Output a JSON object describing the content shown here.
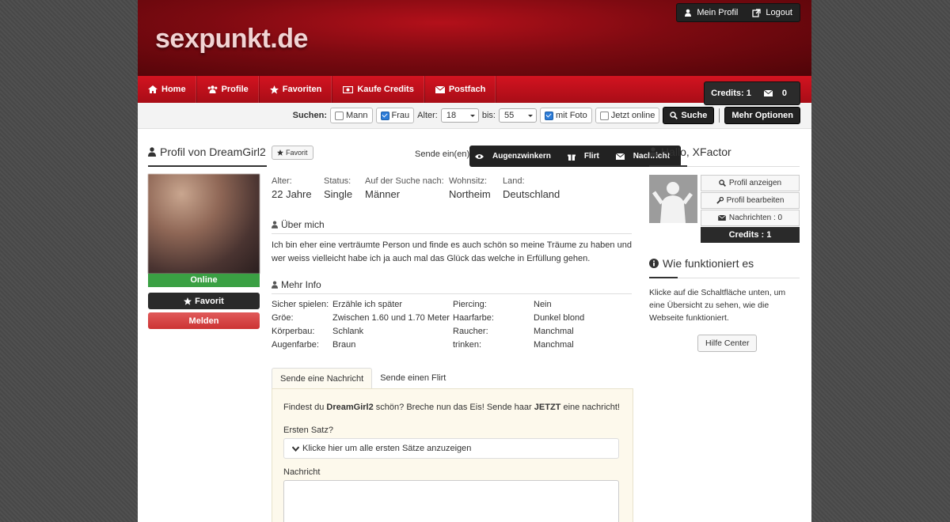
{
  "site": {
    "logo": "sexpunkt.de"
  },
  "toplinks": {
    "profile": "Mein Profil",
    "logout": "Logout"
  },
  "nav": {
    "items": [
      "Home",
      "Profile",
      "Favoriten",
      "Kaufe Credits",
      "Postfach"
    ],
    "credits": "Credits: 1",
    "messages": "0"
  },
  "search": {
    "label": "Suchen:",
    "mann": "Mann",
    "frau": "Frau",
    "alter_label": "Alter:",
    "alter_from": "18",
    "bis_label": "bis:",
    "alter_to": "55",
    "mit_foto": "mit Foto",
    "jetzt_online": "Jetzt online",
    "submit": "Suche",
    "more": "Mehr Optionen"
  },
  "profile": {
    "title": "Profil von DreamGirl2",
    "fav_small": "Favorit",
    "sende_label": "Sende ein(en):",
    "actions": [
      "Augenzwinkern",
      "Flirt",
      "Nachricht"
    ],
    "status_badge": "Online",
    "fav_button": "Favorit",
    "report_button": "Melden",
    "facts": [
      {
        "key": "Alter:",
        "value": "22 Jahre"
      },
      {
        "key": "Status:",
        "value": "Single"
      },
      {
        "key": "Auf der Suche nach:",
        "value": "Männer"
      },
      {
        "key": "Wohnsitz:",
        "value": "Northeim"
      },
      {
        "key": "Land:",
        "value": "Deutschland"
      }
    ],
    "about_title": "Über mich",
    "about_text": "Ich bin eher eine verträumte Person und finde es auch schön so meine Träume zu haben und wer weiss vielleicht habe ich ja auch mal das Glück das welche in Erfüllung gehen.",
    "more_title": "Mehr Info",
    "more_left": [
      {
        "key": "Sicher spielen:",
        "value": "Erzähle ich später"
      },
      {
        "key": "Gröe:",
        "value": "Zwischen 1.60 und 1.70 Meter"
      },
      {
        "key": "Körperbau:",
        "value": "Schlank"
      },
      {
        "key": "Augenfarbe:",
        "value": "Braun"
      }
    ],
    "more_right": [
      {
        "key": "Piercing:",
        "value": "Nein"
      },
      {
        "key": "Haarfarbe:",
        "value": "Dunkel blond"
      },
      {
        "key": "Raucher:",
        "value": "Manchmal"
      },
      {
        "key": "trinken:",
        "value": "Manchmal"
      }
    ]
  },
  "message": {
    "tabs": [
      "Sende eine Nachricht",
      "Sende einen Flirt"
    ],
    "intro_pre": "Findest du ",
    "intro_name": "DreamGirl2",
    "intro_mid": " schön? Breche nun das Eis! Sende haar ",
    "intro_bold": "JETZT",
    "intro_post": " eine nachricht!",
    "first_label": "Ersten Satz?",
    "first_dropdown": "Klicke hier um alle ersten Sätze anzuzeigen",
    "message_label": "Nachricht"
  },
  "sidebar": {
    "greeting": "Hallo, XFactor",
    "buttons": [
      "Profil anzeigen",
      "Profil bearbeiten",
      "Nachrichten : 0"
    ],
    "credits": "Credits : 1",
    "how_title": "Wie funktioniert es",
    "how_text": "Klicke auf die Schaltfläche unten, um eine Übersicht zu sehen, wie die Webseite funktioniert.",
    "help_button": "Hilfe Center"
  }
}
